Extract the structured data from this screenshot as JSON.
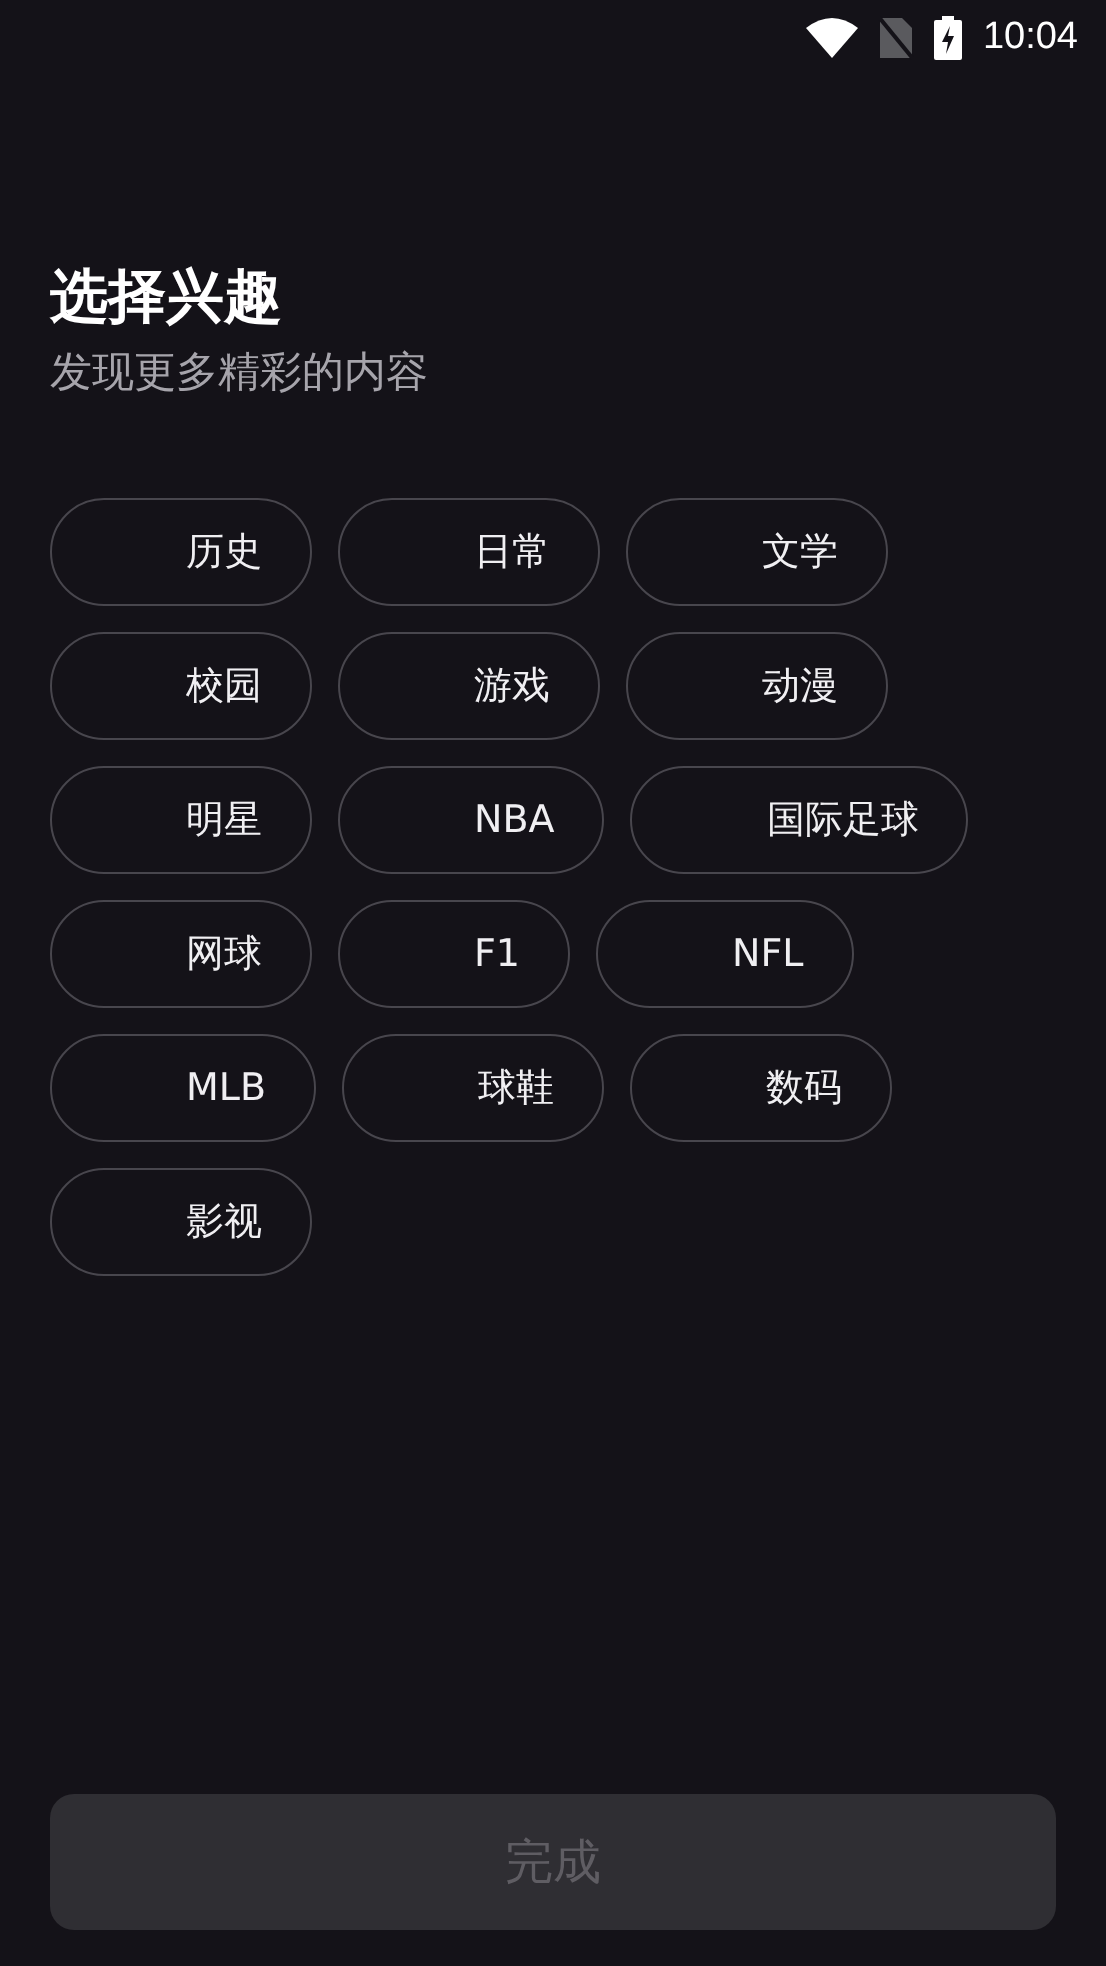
{
  "status_bar": {
    "time": "10:04"
  },
  "header": {
    "title": "选择兴趣",
    "subtitle": "发现更多精彩的内容"
  },
  "interests": [
    {
      "label": "历史",
      "selected": false
    },
    {
      "label": "日常",
      "selected": false
    },
    {
      "label": "文学",
      "selected": false
    },
    {
      "label": "校园",
      "selected": false
    },
    {
      "label": "游戏",
      "selected": false
    },
    {
      "label": "动漫",
      "selected": false
    },
    {
      "label": "明星",
      "selected": false
    },
    {
      "label": "NBA",
      "selected": false
    },
    {
      "label": "国际足球",
      "selected": false
    },
    {
      "label": "网球",
      "selected": false
    },
    {
      "label": "F1",
      "selected": false
    },
    {
      "label": "NFL",
      "selected": false
    },
    {
      "label": "MLB",
      "selected": false
    },
    {
      "label": "球鞋",
      "selected": false
    },
    {
      "label": "数码",
      "selected": false
    },
    {
      "label": "影视",
      "selected": false
    }
  ],
  "done_button": {
    "label": "完成",
    "disabled": true
  }
}
